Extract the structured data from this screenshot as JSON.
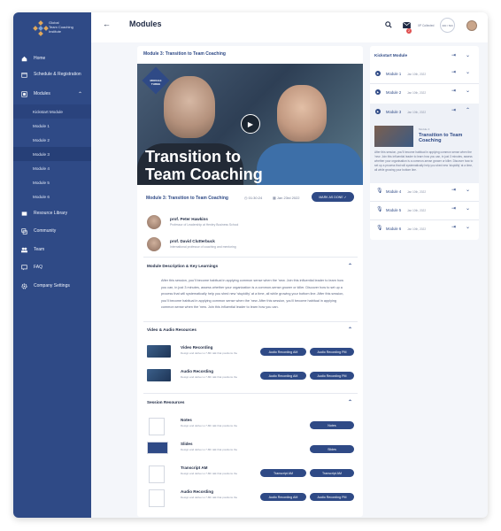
{
  "brand": {
    "logo_text_1": "Global",
    "logo_text_2": "Team Coaching",
    "logo_text_3": "Institute"
  },
  "sidebar": {
    "items": [
      {
        "label": "Home",
        "icon": "home-icon"
      },
      {
        "label": "Schedule & Registration",
        "icon": "calendar-icon"
      },
      {
        "label": "Modules",
        "icon": "modules-icon"
      },
      {
        "label": "Resource Library",
        "icon": "library-icon"
      },
      {
        "label": "Community",
        "icon": "community-icon"
      },
      {
        "label": "Team",
        "icon": "team-icon"
      },
      {
        "label": "FAQ",
        "icon": "faq-icon"
      },
      {
        "label": "Company Settings",
        "icon": "gear-icon"
      }
    ],
    "sub_items": [
      "Kickstart Module",
      "Module 1",
      "Module 2",
      "Module 3",
      "Module 4",
      "Module 5",
      "Module 6"
    ]
  },
  "header": {
    "back": "←",
    "title": "Modules",
    "notifications_count": "2",
    "collected_label": "XP Collected",
    "ring_text": "300 / 500"
  },
  "module": {
    "heading": "Module 3: Transition to Team Coaching",
    "hero_badge": "MODULE THREE",
    "hero_title_1": "Transition to",
    "hero_title_2": "Team Coaching",
    "info_title": "Module 3: Transition to Team Coaching",
    "duration": "01:30:24",
    "date": "Jan 23rd 2022",
    "mark_done": "MARK AS DONE"
  },
  "people": [
    {
      "name": "prof. Peter Hawkins",
      "role": "Professor of Leadership at Henley Business School"
    },
    {
      "name": "prof. David Clutterbuck",
      "role": "International professor of coaching and mentoring"
    }
  ],
  "sections": {
    "description_title": "Module Description & Key Learnings",
    "description_text": "After this session, you'll become habitual in applying common sense when the 'new. Join this influential leader to learn how you can, in just 3 minutes, assess whether your organization is a common-sense grower or killer. Discover how to set up a process that will systematically help you shed new 'stupidity' at a time, all while growing your bottom line. After this session, you'll become habitual in applying common sense when the 'new. After this session, you'll become habitual in applying common sense when the 'new. Join this influential leader to learn how you can.",
    "video_title": "Video & Audio Resources",
    "session_title": "Session Resources"
  },
  "video_resources": [
    {
      "name": "Video Recording",
      "desc": "Design and deliver a 7-8th talk that positions the",
      "btn1": "Audio Recording AM",
      "btn2": "Audio Recording PM"
    },
    {
      "name": "Audio Recording",
      "desc": "Design and deliver a 7-8th talk that positions the",
      "btn1": "Audio Recording AM",
      "btn2": "Audio Recording PM"
    }
  ],
  "session_resources": [
    {
      "name": "Notes",
      "desc": "Design and deliver a 7-8th talk that positions the",
      "btn1": "",
      "btn2": "Notes"
    },
    {
      "name": "Slides",
      "desc": "Design and deliver a 7-8th talk that positions the",
      "btn1": "",
      "btn2": "Slides"
    },
    {
      "name": "Transcript AM",
      "desc": "Design and deliver a 7-8th talk that positions the",
      "btn1": "Transcript AM",
      "btn2": "Transcript AM"
    },
    {
      "name": "Audio Recording",
      "desc": "Design and deliver a 7-8th talk that positions the",
      "btn1": "Audio Recording AM",
      "btn2": "Audio Recording PM"
    }
  ],
  "right_panel": {
    "heading": "Kickstart Module",
    "rows": [
      {
        "label": "Module 1",
        "date": "Jan 10th, 2022",
        "kind": "video"
      },
      {
        "label": "Module 2",
        "date": "Jan 10th, 2022",
        "kind": "video"
      },
      {
        "label": "Module 3",
        "date": "Jan 10th, 2022",
        "kind": "video"
      },
      {
        "label": "Module 4",
        "date": "Jan 10th, 2022",
        "kind": "audio"
      },
      {
        "label": "Module 5",
        "date": "Jan 10th, 2022",
        "kind": "audio"
      },
      {
        "label": "Module 6",
        "date": "Jan 10th, 2022",
        "kind": "audio"
      }
    ],
    "detail_meta": "Module 3",
    "detail_title": "Transition to Team Coaching",
    "detail_text": "After this session, you'll become habitual in applying common sense when the 'new. Join this influential leader to learn how you can, in just 3 minutes, assess whether your organisation is a common-sense grower or killer. Discover how to set up a process that will systematically help you shed new 'stupidity' at a time, all while growing your bottom line."
  },
  "colors": {
    "brand": "#2f4a86",
    "accent_red": "#e05151"
  }
}
